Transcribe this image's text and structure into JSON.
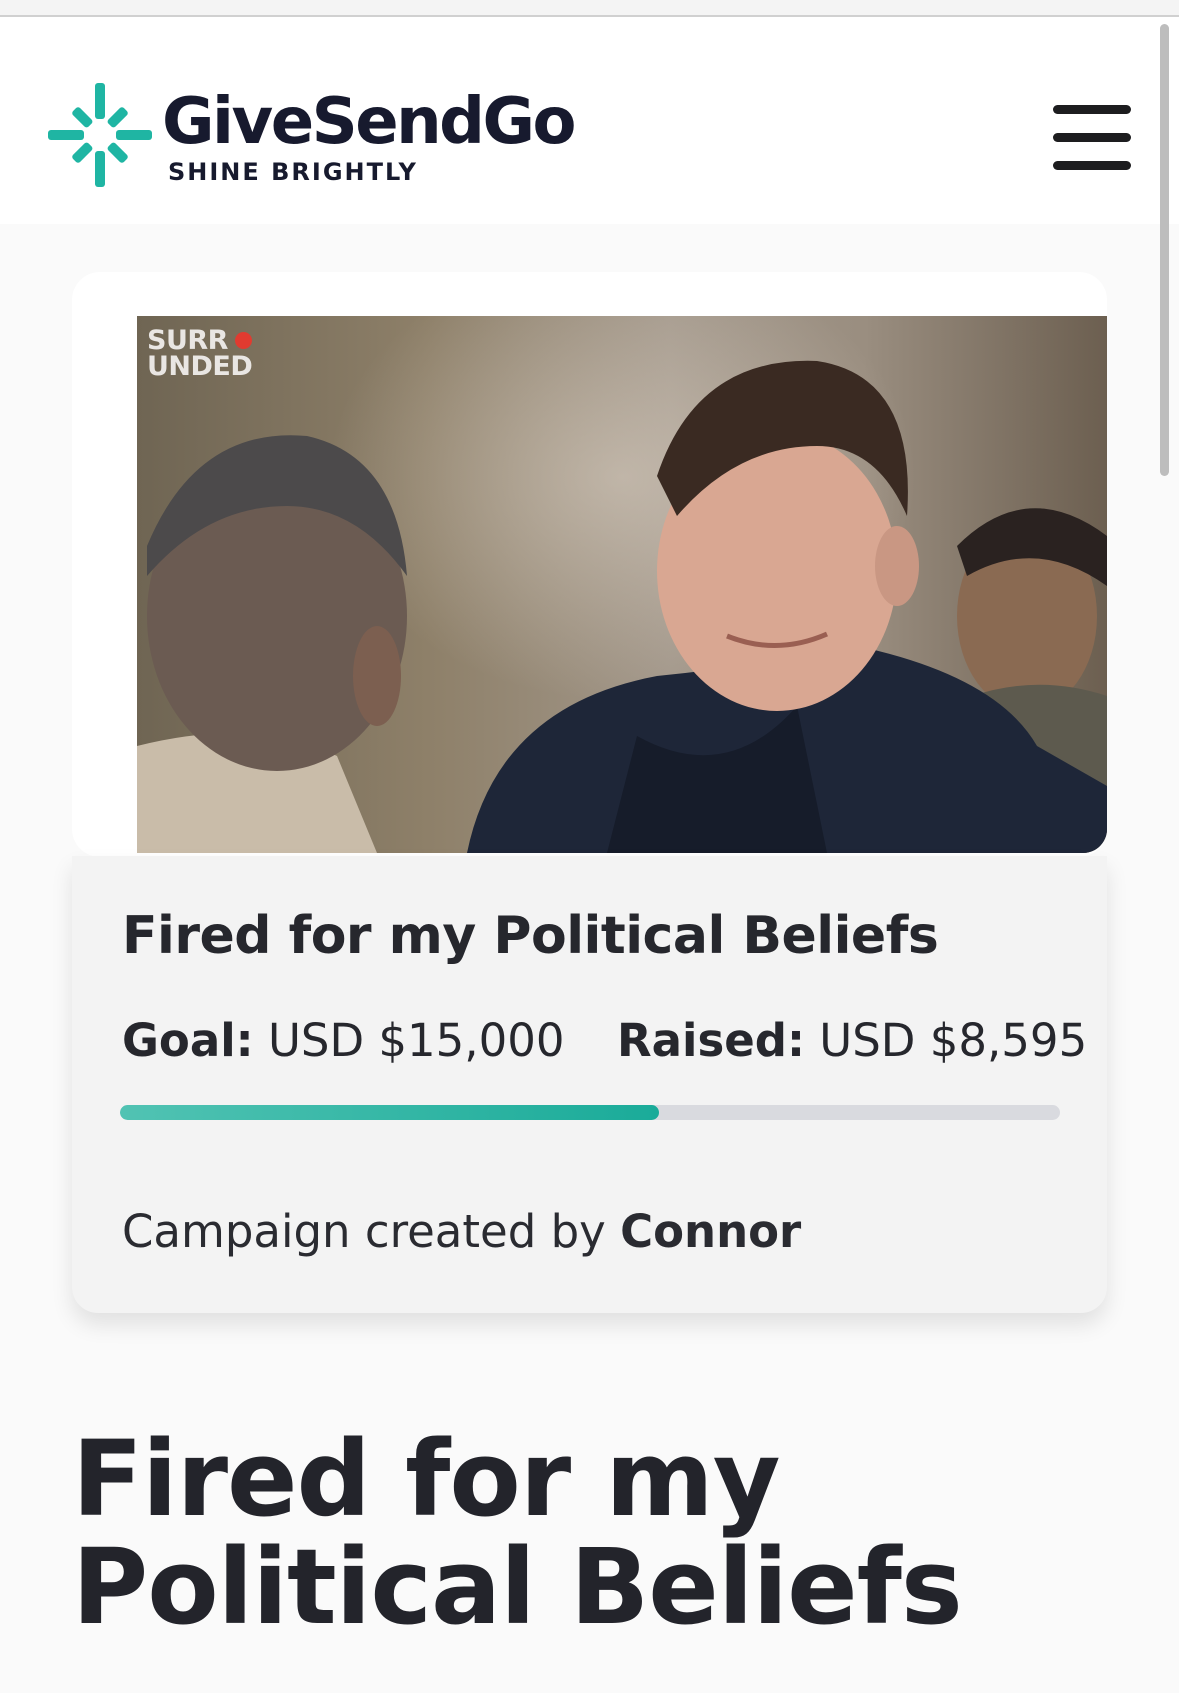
{
  "header": {
    "brand_name": "GiveSendGo",
    "tagline": "SHINE BRIGHTLY",
    "brand_color": "#1fb5a3",
    "menu_icon": "hamburger-menu-icon"
  },
  "campaign": {
    "image": {
      "watermark_line1": "SURR",
      "watermark_line2": "UNDED",
      "description_icon": "campaign-photo"
    },
    "card_title": "Fired for my Political Beliefs",
    "goal_label": "Goal:",
    "goal_value": "USD $15,000",
    "raised_label": "Raised:",
    "raised_value": "USD $8,595",
    "progress_fraction": 0.573,
    "progress_color": "#1aab99",
    "creator_prefix": "Campaign created by",
    "creator_name": "Connor",
    "page_title_line1": "Fired for my",
    "page_title_line2": "Political Beliefs"
  }
}
